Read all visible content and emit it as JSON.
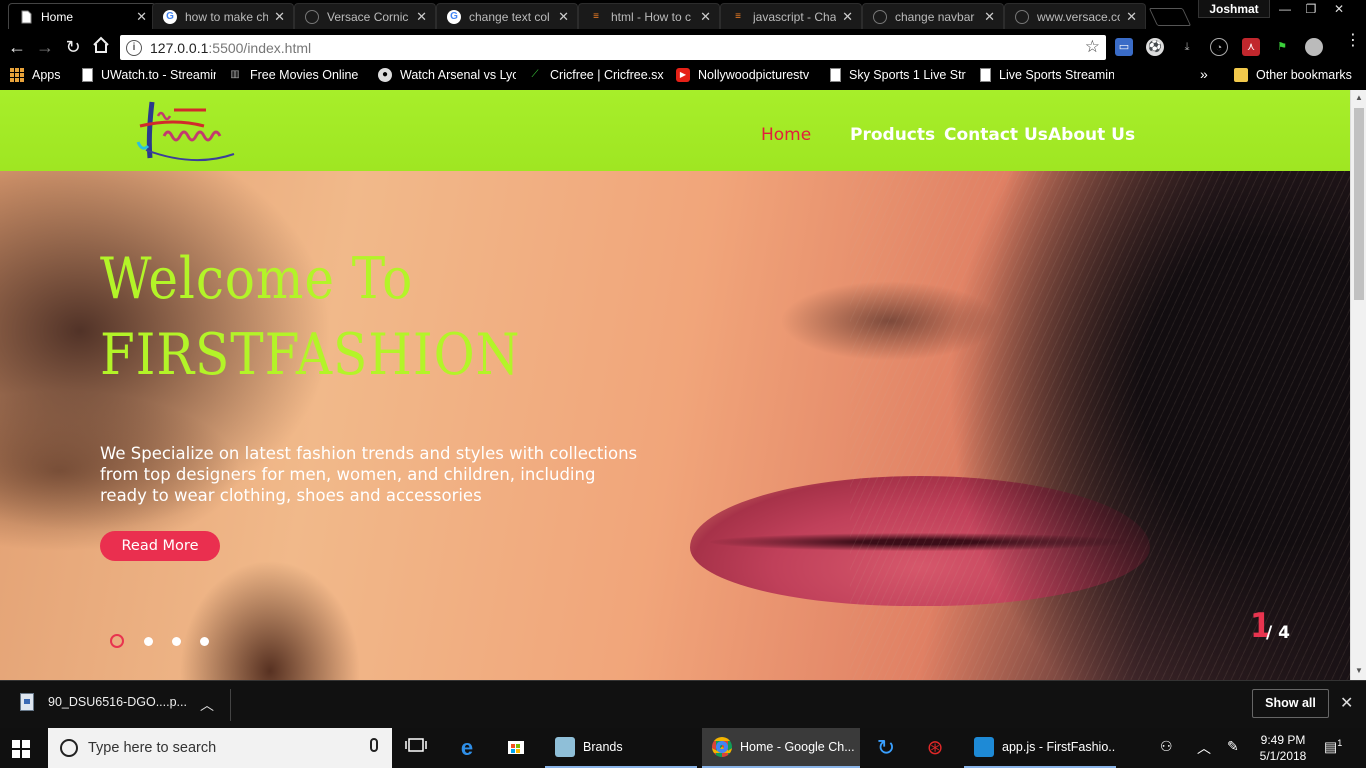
{
  "browser": {
    "tabs": [
      {
        "title": "Home",
        "icon": "page-icon",
        "active": true
      },
      {
        "title": "how to make ch",
        "icon": "google-icon"
      },
      {
        "title": "Versace Cornic",
        "icon": "globe-icon"
      },
      {
        "title": "change text col",
        "icon": "google-icon"
      },
      {
        "title": "html - How to c",
        "icon": "stackoverflow-icon"
      },
      {
        "title": "javascript - Cha",
        "icon": "stackoverflow-icon"
      },
      {
        "title": "change navbar",
        "icon": "globe-icon"
      },
      {
        "title": "www.versace.co",
        "icon": "globe-icon"
      }
    ],
    "profile_name": "Joshmat",
    "url_host": "127.0.0.1",
    "url_path": ":5500/index.html",
    "bookmarks": [
      {
        "label": "Apps",
        "icon": "apps-icon"
      },
      {
        "label": "UWatch.to - Streamin",
        "icon": "page-icon"
      },
      {
        "label": "Free Movies Online",
        "icon": "film-icon"
      },
      {
        "label": "Watch Arsenal vs Lyo",
        "icon": "soccer-icon"
      },
      {
        "label": "Cricfree | Cricfree.sx",
        "icon": "cricket-icon"
      },
      {
        "label": "Nollywoodpicturestv",
        "icon": "youtube-icon"
      },
      {
        "label": "Sky Sports 1 Live Str",
        "icon": "page-icon"
      },
      {
        "label": "Live Sports Streamin",
        "icon": "page-icon"
      }
    ],
    "bookmarks_overflow": "»",
    "other_bookmarks": "Other bookmarks"
  },
  "site": {
    "nav": [
      {
        "label": "Home",
        "active": true
      },
      {
        "label": "Products"
      },
      {
        "label": "Contact Us"
      },
      {
        "label": "About Us"
      }
    ],
    "hero": {
      "title_line1": "Welcome To",
      "title_line2": "FIRSTFASHION",
      "text": "We Specialize on latest fashion trends and styles with collections from top designers for men, women, and children, including ready to wear clothing, shoes and accessories",
      "button": "Read More",
      "slide_current": "1",
      "slide_total": "/ 4",
      "dots": 4
    },
    "colors": {
      "nav_bg": "#a7ee2a",
      "accent": "#ea2f4f",
      "title": "#b3f428"
    }
  },
  "downloads": {
    "file": "90_DSU6516-DGO....p...",
    "show_all": "Show all"
  },
  "taskbar": {
    "search_placeholder": "Type here to search",
    "apps": [
      {
        "label": "Brands",
        "icon": "folder-icon"
      },
      {
        "label": "Home - Google Ch...",
        "icon": "chrome-icon",
        "active": true
      },
      {
        "label": "app.js - FirstFashio...",
        "icon": "vscode-icon"
      }
    ],
    "time": "9:49 PM",
    "date": "5/1/2018",
    "notifications": "1"
  }
}
